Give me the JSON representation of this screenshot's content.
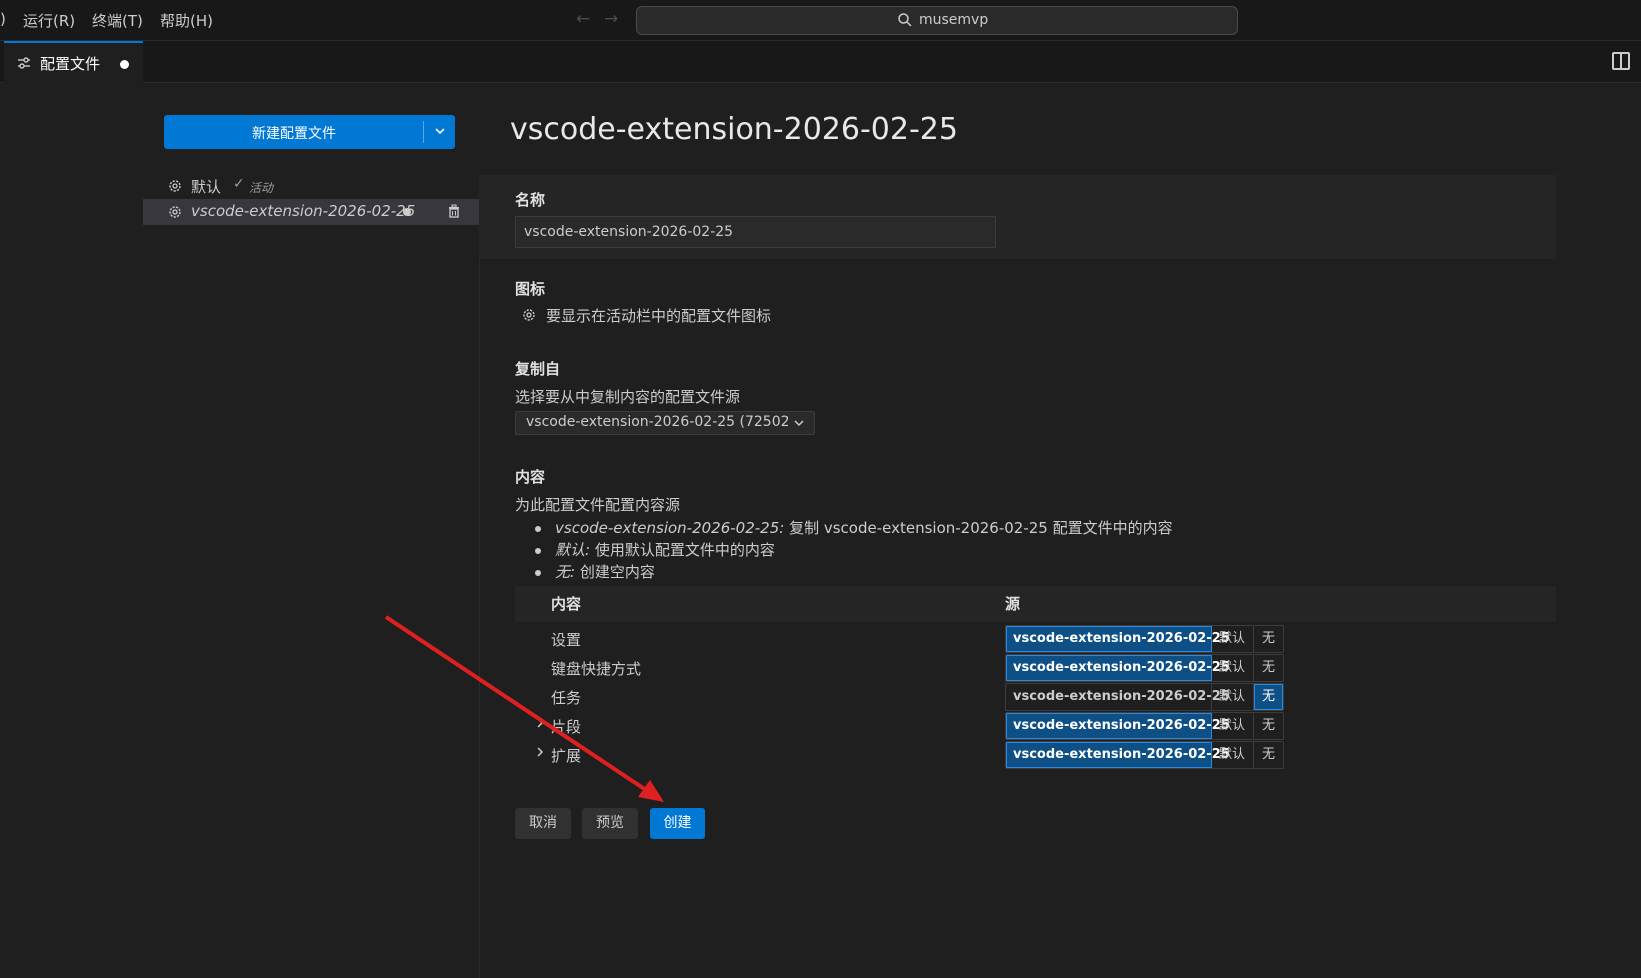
{
  "menubar": {
    "items": [
      ")",
      "运行(R)",
      "终端(T)",
      "帮助(H)"
    ],
    "search_text": "musemvp"
  },
  "tab": {
    "label": "配置文件",
    "modified": true
  },
  "sidebar": {
    "new_button_label": "新建配置文件",
    "profiles": [
      {
        "name": "默认",
        "status": "活动",
        "icon": "gear-icon"
      },
      {
        "name": "vscode-extension-2026-02-25",
        "icon": "gear-icon",
        "modified": true
      }
    ]
  },
  "main": {
    "title": "vscode-extension-2026-02-25",
    "name_section": {
      "title": "名称",
      "value": "vscode-extension-2026-02-25"
    },
    "icon_section": {
      "title": "图标",
      "description": "要显示在活动栏中的配置文件图标"
    },
    "copy_section": {
      "title": "复制自",
      "description": "选择要从中复制内容的配置文件源",
      "selected": "vscode-extension-2026-02-25 (72502"
    },
    "contents_section": {
      "title": "内容",
      "description": "为此配置文件配置内容源",
      "bullets": [
        {
          "term": "vscode-extension-2026-02-25:",
          "text": " 复制 vscode-extension-2026-02-25 配置文件中的内容"
        },
        {
          "term": "默认:",
          "text": " 使用默认配置文件中的内容"
        },
        {
          "term": "无:",
          "text": " 创建空内容"
        }
      ],
      "table": {
        "headers": [
          "内容",
          "源"
        ],
        "options": [
          "vscode-extension-2026-02-25",
          "默认",
          "无"
        ],
        "rows": [
          {
            "label": "设置",
            "expandable": false,
            "selected": 0
          },
          {
            "label": "键盘快捷方式",
            "expandable": false,
            "selected": 0
          },
          {
            "label": "任务",
            "expandable": false,
            "selected": 2
          },
          {
            "label": "片段",
            "expandable": true,
            "selected": 0
          },
          {
            "label": "扩展",
            "expandable": true,
            "selected": 0
          }
        ]
      }
    },
    "buttons": {
      "cancel": "取消",
      "preview": "预览",
      "create": "创建"
    }
  },
  "colors": {
    "accent": "#0078d4",
    "annotation_arrow": "#e02020"
  }
}
